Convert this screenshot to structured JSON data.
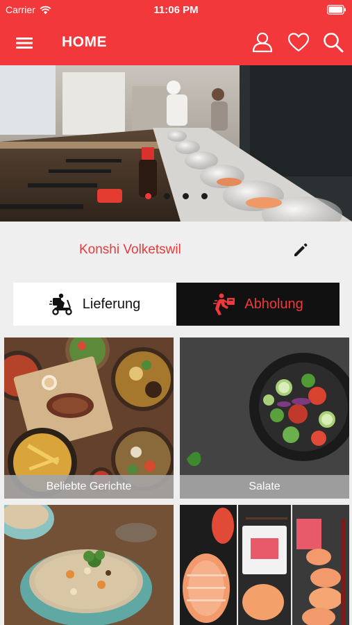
{
  "status_bar": {
    "carrier": "Carrier",
    "time": "11:06 PM",
    "icons": [
      "wifi-icon",
      "battery-icon"
    ]
  },
  "nav": {
    "title": "HOME",
    "icons": [
      "menu-icon",
      "user-icon",
      "heart-icon",
      "search-icon"
    ]
  },
  "hero": {
    "slide_count": 4,
    "active_index": 0
  },
  "branch": {
    "name": "Konshi Volketswil",
    "icon": "pencil-icon"
  },
  "order_mode": {
    "options": [
      {
        "label": "Lieferung",
        "icon": "delivery-scooter-icon",
        "selected": false
      },
      {
        "label": "Abholung",
        "icon": "pickup-runner-icon",
        "selected": true
      }
    ]
  },
  "categories": [
    {
      "label": "Beliebte Gerichte"
    },
    {
      "label": "Salate"
    },
    {
      "label": ""
    },
    {
      "label": ""
    }
  ],
  "colors": {
    "primary": "#f2383a",
    "dark": "#111111",
    "background": "#efefef",
    "label_overlay": "#a5a5a5"
  }
}
